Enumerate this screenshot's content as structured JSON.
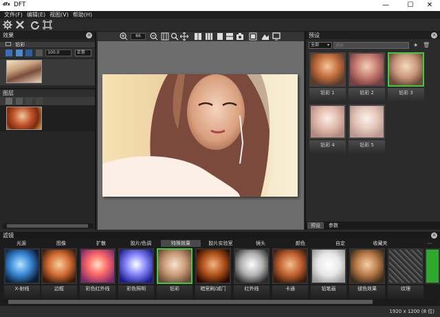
{
  "window": {
    "logo": "dfx",
    "title": "DFT",
    "minimize": "—",
    "maximize": "☐",
    "close": "✕"
  },
  "menu": [
    "文件(F)",
    "编辑(E)",
    "视图(V)",
    "帮助(H)"
  ],
  "left": {
    "effects_title": "效果",
    "effect_name": "铅彩",
    "opacity_value": "100.0",
    "blend_mode": "正常",
    "layers_title": "图层"
  },
  "center": {
    "zoom_value": "86"
  },
  "right": {
    "presets_title": "预设",
    "filter_value": "全部",
    "search_placeholder": "搜索",
    "presets": [
      {
        "label": "铅彩 1",
        "selected": false
      },
      {
        "label": "铅彩 2",
        "selected": false
      },
      {
        "label": "铅彩 3",
        "selected": true
      },
      {
        "label": "铅彩 4",
        "selected": false
      },
      {
        "label": "铅彩 5",
        "selected": false
      }
    ],
    "tabs": [
      "预设",
      "参数"
    ]
  },
  "bottom": {
    "filters_title": "滤镜",
    "categories": [
      "光源",
      "图像",
      "扩散",
      "胶片/色调",
      "特殊效果",
      "胶片实验室",
      "镜头",
      "颜色",
      "自定",
      "收藏夹"
    ],
    "active_category": "特殊效果",
    "filters": [
      {
        "label": "X-射线",
        "selected": false
      },
      {
        "label": "边框",
        "selected": false
      },
      {
        "label": "彩色红外线",
        "selected": false
      },
      {
        "label": "彩色照明",
        "selected": false
      },
      {
        "label": "铅彩",
        "selected": true
      },
      {
        "label": "暗室刷/减门",
        "selected": false
      },
      {
        "label": "红外线",
        "selected": false
      },
      {
        "label": "卡通",
        "selected": false
      },
      {
        "label": "铅笔画",
        "selected": false
      },
      {
        "label": "褪色效果",
        "selected": false
      },
      {
        "label": "纹理",
        "selected": false
      }
    ],
    "status": "1920 x 1200 (8 位)"
  },
  "colors": {
    "accent_selected": "#3ecc3e",
    "panel_bg": "#262626",
    "canvas_bg": "#6d6d6d"
  }
}
